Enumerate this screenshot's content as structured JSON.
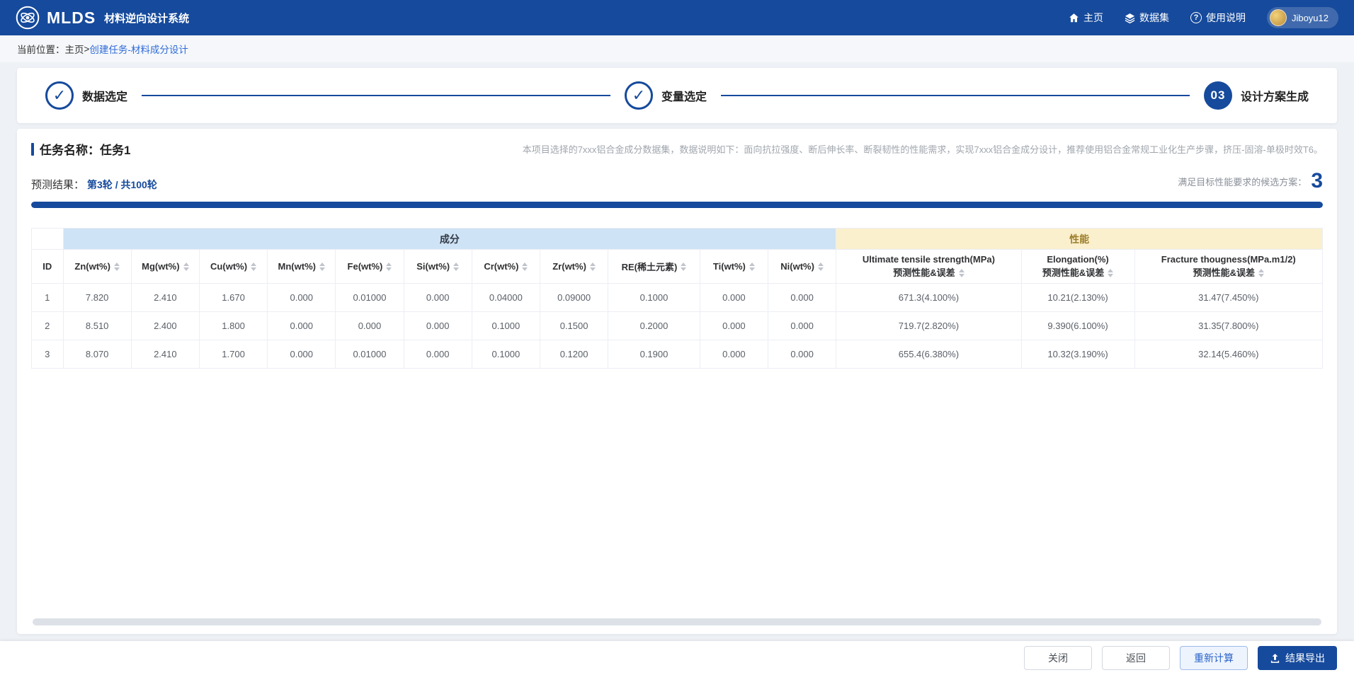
{
  "colors": {
    "accent": "#164a9c",
    "link": "#2f6bd8",
    "comp_band_bg": "#cfe3f6",
    "perf_band_bg": "#fbf0cd",
    "perf_band_text": "#9c7d2a"
  },
  "navbar": {
    "brand": "MLDS",
    "brand_sub": "材料逆向设计系统",
    "menu": [
      {
        "label": "主页",
        "icon": "home-icon"
      },
      {
        "label": "数据集",
        "icon": "dataset-icon"
      },
      {
        "label": "使用说明",
        "icon": "help-icon"
      }
    ],
    "help_glyph": "?",
    "user": {
      "name": "Jiboyu12"
    }
  },
  "breadcrumb": {
    "prefix": "当前位置：",
    "home": "主页",
    "separator": ">",
    "current": "创建任务-材料成分设计"
  },
  "steps": [
    {
      "label": "数据选定",
      "state": "done",
      "icon": "✓"
    },
    {
      "label": "变量选定",
      "state": "done",
      "icon": "✓"
    },
    {
      "label": "设计方案生成",
      "state": "current",
      "badge": "03"
    }
  ],
  "task": {
    "name_label": "任务名称：任务1",
    "description": "本项目选择的7xxx铝合金成分数据集，数据说明如下：面向抗拉强度、断后伸长率、断裂韧性的性能需求，实现7xxx铝合金成分设计，推荐使用铝合金常规工业化生产步骤，挤压-固溶-单极时效T6。",
    "result_label": "预测结果：",
    "round_info": "第3轮 / 共100轮",
    "candidate_label": "满足目标性能要求的候选方案：",
    "candidate_count": "3",
    "progress_percent": 100
  },
  "table": {
    "group_headers": {
      "composition": "成分",
      "performance": "性能"
    },
    "id_header": "ID",
    "composition_columns": [
      "Zn(wt%)",
      "Mg(wt%)",
      "Cu(wt%)",
      "Mn(wt%)",
      "Fe(wt%)",
      "Si(wt%)",
      "Cr(wt%)",
      "Zr(wt%)",
      "RE(稀土元素)",
      "Ti(wt%)",
      "Ni(wt%)"
    ],
    "performance_columns": [
      {
        "line1": "Ultimate tensile strength(MPa)",
        "line2": "预测性能&误差"
      },
      {
        "line1": "Elongation(%)",
        "line2": "预测性能&误差"
      },
      {
        "line1": "Fracture thougness(MPa.m1/2)",
        "line2": "预测性能&误差"
      }
    ],
    "rows": [
      {
        "id": "1",
        "comp": [
          "7.820",
          "2.410",
          "1.670",
          "0.000",
          "0.01000",
          "0.000",
          "0.04000",
          "0.09000",
          "0.1000",
          "0.000",
          "0.000"
        ],
        "perf": [
          "671.3(4.100%)",
          "10.21(2.130%)",
          "31.47(7.450%)"
        ]
      },
      {
        "id": "2",
        "comp": [
          "8.510",
          "2.400",
          "1.800",
          "0.000",
          "0.000",
          "0.000",
          "0.1000",
          "0.1500",
          "0.2000",
          "0.000",
          "0.000"
        ],
        "perf": [
          "719.7(2.820%)",
          "9.390(6.100%)",
          "31.35(7.800%)"
        ]
      },
      {
        "id": "3",
        "comp": [
          "8.070",
          "2.410",
          "1.700",
          "0.000",
          "0.01000",
          "0.000",
          "0.1000",
          "0.1200",
          "0.1900",
          "0.000",
          "0.000"
        ],
        "perf": [
          "655.4(6.380%)",
          "10.32(3.190%)",
          "32.14(5.460%)"
        ]
      }
    ]
  },
  "footer": {
    "buttons": [
      {
        "label": "关闭",
        "type": "default"
      },
      {
        "label": "返回",
        "type": "default"
      },
      {
        "label": "重新计算",
        "type": "outline-primary"
      },
      {
        "label": "结果导出",
        "type": "primary",
        "icon": "export-icon"
      }
    ]
  }
}
